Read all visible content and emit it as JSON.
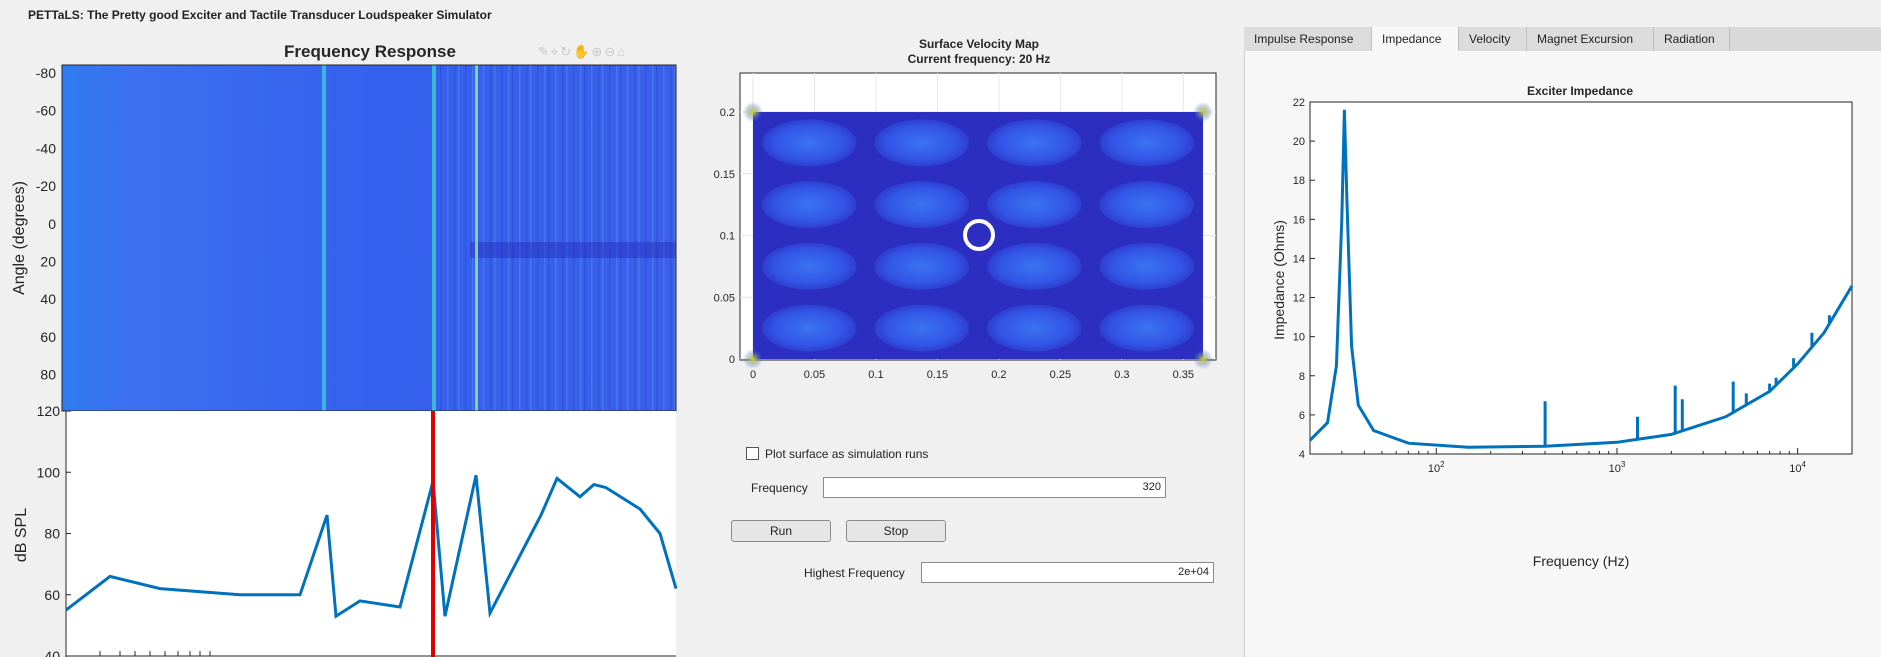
{
  "app": {
    "title": "PETTaLS: The Pretty good Exciter and Tactile Transducer Loudspeaker Simulator"
  },
  "freq_response": {
    "title": "Frequency Response",
    "heatmap_ylabel": "Angle (degrees)",
    "heatmap_yticks": [
      "-80",
      "-60",
      "-40",
      "-20",
      "0",
      "20",
      "40",
      "60",
      "80"
    ],
    "spl_ylabel": "dB SPL",
    "spl_yticks": [
      "120",
      "100",
      "80",
      "60",
      "40"
    ],
    "toolbar_icons": [
      "brush-icon",
      "data-tip-icon",
      "rotate-icon",
      "pan-icon",
      "zoom-in-icon",
      "zoom-out-icon",
      "home-icon"
    ]
  },
  "velocity_map": {
    "title": "Surface Velocity Map",
    "subtitle": "Current frequency: 20 Hz",
    "xticks": [
      "0",
      "0.05",
      "0.1",
      "0.15",
      "0.2",
      "0.25",
      "0.3",
      "0.35"
    ],
    "yticks": [
      "0.2",
      "0.15",
      "0.1",
      "0.05",
      "0"
    ]
  },
  "controls": {
    "plot_surface_label": "Plot surface as simulation runs",
    "plot_surface_checked": false,
    "frequency_label": "Frequency",
    "frequency_value": "320",
    "run_label": "Run",
    "stop_label": "Stop",
    "highest_freq_label": "Highest Frequency",
    "highest_freq_value": "2e+04"
  },
  "tabs": [
    {
      "label": "Impulse Response",
      "active": false
    },
    {
      "label": "Impedance",
      "active": true
    },
    {
      "label": "Velocity",
      "active": false
    },
    {
      "label": "Magnet Excursion",
      "active": false
    },
    {
      "label": "Radiation",
      "active": false
    }
  ],
  "chart_data": [
    {
      "type": "line",
      "title": "Exciter Impedance",
      "xlabel": "Frequency (Hz)",
      "ylabel": "Impedance (Ohms)",
      "xscale": "log",
      "xlim": [
        20,
        20000
      ],
      "ylim": [
        4,
        22
      ],
      "yticks": [
        "22",
        "20",
        "18",
        "16",
        "14",
        "12",
        "10",
        "8",
        "6",
        "4"
      ],
      "xticks": [
        "10^2",
        "10^3",
        "10^4"
      ],
      "color": "#0072bd",
      "x": [
        20,
        25,
        28,
        30,
        31,
        32,
        34,
        37,
        45,
        70,
        150,
        400,
        1000,
        2000,
        4000,
        7000,
        10000,
        14000,
        20000
      ],
      "values": [
        4.7,
        5.6,
        8.5,
        16,
        21.6,
        17,
        9.5,
        6.5,
        5.2,
        4.55,
        4.35,
        4.4,
        4.6,
        5.0,
        5.9,
        7.2,
        8.6,
        10.2,
        12.6
      ]
    },
    {
      "type": "line",
      "title": "",
      "xlabel": "",
      "ylabel": "dB SPL",
      "xscale": "log",
      "ylim": [
        40,
        120
      ],
      "color": "#0072bd",
      "marker_color": "#e00000",
      "values_description_points": [
        55,
        66,
        62,
        60,
        60,
        86,
        53,
        58,
        56,
        97,
        53,
        99,
        54,
        86,
        98,
        92,
        96,
        95,
        88,
        80,
        62
      ]
    }
  ]
}
